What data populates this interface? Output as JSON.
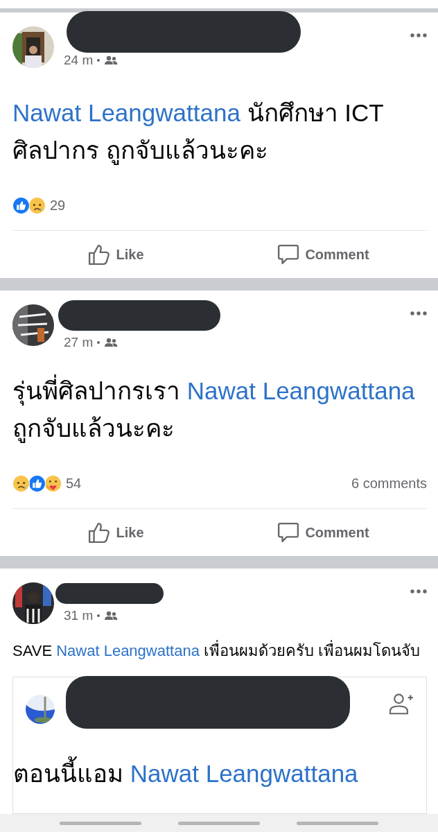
{
  "posts": [
    {
      "kind": "status",
      "time": "24 m",
      "text": [
        {
          "kind": "mention",
          "text": "Nawat Leangwattana"
        },
        {
          "kind": "text",
          "text": " นักศึกษา ICT ศิลปากร ถูกจับแล้วนะคะ"
        }
      ],
      "reactions": [
        {
          "kind": "like"
        },
        {
          "kind": "sad"
        }
      ],
      "reaction_count": "29",
      "actions": [
        "Like",
        "Comment"
      ]
    },
    {
      "kind": "status",
      "time": "27 m",
      "text": [
        {
          "kind": "text",
          "text": "รุ่นพี่ศิลปากรเรา "
        },
        {
          "kind": "mention",
          "text": "Nawat Leangwattana"
        },
        {
          "kind": "text",
          "text": " ถูกจับแล้วนะคะ"
        }
      ],
      "reactions": [
        {
          "kind": "sad"
        },
        {
          "kind": "like"
        },
        {
          "kind": "care"
        }
      ],
      "reaction_count": "54",
      "comments": "6 comments",
      "actions": [
        "Like",
        "Comment"
      ]
    },
    {
      "kind": "share",
      "time": "31 m",
      "text": [
        {
          "kind": "text",
          "text": "SAVE "
        },
        {
          "kind": "mention",
          "text": "Nawat Leangwattana"
        },
        {
          "kind": "text",
          "text": " เพื่อนผมด้วยครับ เพื่อนผมโดนจับ"
        }
      ],
      "shared": {
        "text": [
          {
            "kind": "text",
            "text": "ตอนนี้แอม "
          },
          {
            "kind": "mention",
            "text": "Nawat Leangwattana"
          }
        ]
      }
    }
  ]
}
